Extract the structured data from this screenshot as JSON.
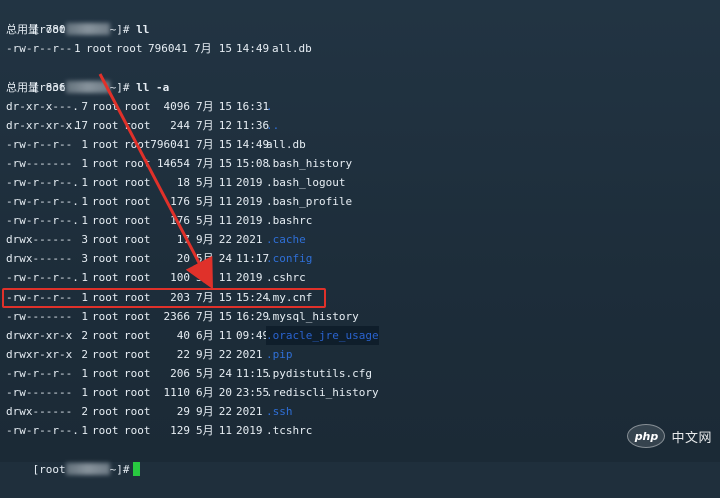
{
  "prompts": [
    {
      "prefix": "[root",
      "suffix": "~]#",
      "command": " ll"
    },
    {
      "prefix": "[root",
      "suffix": "~]#",
      "command": " ll -a"
    },
    {
      "prefix": "[root",
      "suffix": "~]#",
      "command": ""
    }
  ],
  "totals": [
    "总用量 780",
    "总用量 836"
  ],
  "first_listing": {
    "perm": "-rw-r--r--",
    "links": "1",
    "owner": "root",
    "group": "root",
    "size": "796041",
    "month": "7月",
    "day": "15",
    "time": "14:49",
    "name": "all.db",
    "type": "file"
  },
  "listing": [
    {
      "perm": "dr-xr-x---.",
      "links": "7",
      "owner": "root",
      "group": "root",
      "size": "4096",
      "month": "7月",
      "day": "15",
      "time": "16:31",
      "name": ".",
      "type": "dir"
    },
    {
      "perm": "dr-xr-xr-x.",
      "links": "17",
      "owner": "root",
      "group": "root",
      "size": "244",
      "month": "7月",
      "day": "12",
      "time": "11:36",
      "name": "..",
      "type": "dir"
    },
    {
      "perm": "-rw-r--r--",
      "links": "1",
      "owner": "root",
      "group": "root",
      "size": "796041",
      "month": "7月",
      "day": "15",
      "time": "14:49",
      "name": "all.db",
      "type": "file"
    },
    {
      "perm": "-rw-------",
      "links": "1",
      "owner": "root",
      "group": "root",
      "size": "14654",
      "month": "7月",
      "day": "15",
      "time": "15:08",
      "name": ".bash_history",
      "type": "file"
    },
    {
      "perm": "-rw-r--r--.",
      "links": "1",
      "owner": "root",
      "group": "root",
      "size": "18",
      "month": "5月",
      "day": "11",
      "time": "2019",
      "name": ".bash_logout",
      "type": "file"
    },
    {
      "perm": "-rw-r--r--.",
      "links": "1",
      "owner": "root",
      "group": "root",
      "size": "176",
      "month": "5月",
      "day": "11",
      "time": "2019",
      "name": ".bash_profile",
      "type": "file"
    },
    {
      "perm": "-rw-r--r--.",
      "links": "1",
      "owner": "root",
      "group": "root",
      "size": "176",
      "month": "5月",
      "day": "11",
      "time": "2019",
      "name": ".bashrc",
      "type": "file"
    },
    {
      "perm": "drwx------",
      "links": "3",
      "owner": "root",
      "group": "root",
      "size": "17",
      "month": "9月",
      "day": "22",
      "time": "2021",
      "name": ".cache",
      "type": "dir"
    },
    {
      "perm": "drwx------",
      "links": "3",
      "owner": "root",
      "group": "root",
      "size": "20",
      "month": "5月",
      "day": "24",
      "time": "11:17",
      "name": ".config",
      "type": "dir"
    },
    {
      "perm": "-rw-r--r--.",
      "links": "1",
      "owner": "root",
      "group": "root",
      "size": "100",
      "month": "5月",
      "day": "11",
      "time": "2019",
      "name": ".cshrc",
      "type": "file"
    },
    {
      "perm": "-rw-r--r--",
      "links": "1",
      "owner": "root",
      "group": "root",
      "size": "203",
      "month": "7月",
      "day": "15",
      "time": "15:24",
      "name": ".my.cnf",
      "type": "file"
    },
    {
      "perm": "-rw-------",
      "links": "1",
      "owner": "root",
      "group": "root",
      "size": "2366",
      "month": "7月",
      "day": "15",
      "time": "16:29",
      "name": ".mysql_history",
      "type": "file"
    },
    {
      "perm": "drwxr-xr-x",
      "links": "2",
      "owner": "root",
      "group": "root",
      "size": "40",
      "month": "6月",
      "day": "11",
      "time": "09:49",
      "name": ".oracle_jre_usage",
      "type": "dir-hi"
    },
    {
      "perm": "drwxr-xr-x",
      "links": "2",
      "owner": "root",
      "group": "root",
      "size": "22",
      "month": "9月",
      "day": "22",
      "time": "2021",
      "name": ".pip",
      "type": "dir"
    },
    {
      "perm": "-rw-r--r--",
      "links": "1",
      "owner": "root",
      "group": "root",
      "size": "206",
      "month": "5月",
      "day": "24",
      "time": "11:15",
      "name": ".pydistutils.cfg",
      "type": "file"
    },
    {
      "perm": "-rw-------",
      "links": "1",
      "owner": "root",
      "group": "root",
      "size": "1110",
      "month": "6月",
      "day": "20",
      "time": "23:55",
      "name": ".rediscli_history",
      "type": "file"
    },
    {
      "perm": "drwx------",
      "links": "2",
      "owner": "root",
      "group": "root",
      "size": "29",
      "month": "9月",
      "day": "22",
      "time": "2021",
      "name": ".ssh",
      "type": "dir"
    },
    {
      "perm": "-rw-r--r--.",
      "links": "1",
      "owner": "root",
      "group": "root",
      "size": "129",
      "month": "5月",
      "day": "11",
      "time": "2019",
      "name": ".tcshrc",
      "type": "file"
    }
  ],
  "watermark": {
    "logo": "php",
    "text": "中文网"
  },
  "colors": {
    "background": "#1f2f3c",
    "text": "#e6edf3",
    "directory": "#2f6fd6",
    "annotation": "#e0312a",
    "cursor": "#28c840"
  }
}
